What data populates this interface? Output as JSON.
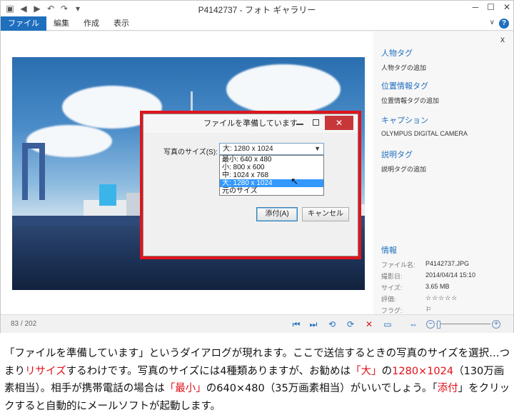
{
  "window": {
    "title": "P4142737 - フォト ギャラリー",
    "min": "─",
    "max": "☐",
    "close": "✕"
  },
  "quick_access": [
    "▣",
    "◀",
    "▶",
    "↶",
    "↷",
    "▾"
  ],
  "menu": {
    "items": [
      "ファイル",
      "編集",
      "作成",
      "表示"
    ],
    "help": "?",
    "collapse": "∨"
  },
  "dialog": {
    "title": "ファイルを準備しています",
    "close": "✕",
    "size_label": "写真のサイズ(S):",
    "selected": "大: 1280 x 1024",
    "options": [
      "最小: 640 x 480",
      "小: 800 x 600",
      "中: 1024 x 768",
      "大: 1280 x 1024",
      "元のサイズ"
    ],
    "highlighted_index": 3,
    "attach_button": "添付(A)",
    "cancel_button": "キャンセル"
  },
  "side_panel": {
    "close": "x",
    "people_tag": {
      "title": "人物タグ",
      "add": "人物タグの追加"
    },
    "geo_tag": {
      "title": "位置情報タグ",
      "add": "位置情報タグの追加"
    },
    "caption": {
      "title": "キャプション",
      "value": "OLYMPUS DIGITAL CAMERA"
    },
    "desc_tag": {
      "title": "説明タグ",
      "add": "説明タグの追加"
    },
    "info": {
      "title": "情報",
      "rows": [
        {
          "key": "ファイル名:",
          "value": "P4142737.JPG"
        },
        {
          "key": "撮影日:",
          "value": "2014/04/14 15:10"
        },
        {
          "key": "サイズ:",
          "value": "3.65 MB"
        },
        {
          "key": "評価:",
          "value": "☆☆☆☆☆"
        },
        {
          "key": "フラグ:",
          "value": "⚐"
        }
      ],
      "rating": 0
    }
  },
  "statusbar": {
    "counter": "83 / 202",
    "tools": [
      "⏮",
      "⏭",
      "⟲",
      "⟳",
      "✕",
      "▭",
      "⇔"
    ],
    "zoom_minus": "−",
    "zoom_plus": "+",
    "zoom_level": 0.02
  },
  "caption": {
    "p1": "「ファイルを準備しています」というダイアログが現れます。ここで送信するときの写真のサイズを選択…つまり",
    "h1": "リサイズ",
    "p2": "するわけです。写真のサイズには4種類ありますが、お勧めは",
    "h2": "「大」",
    "p3": "の",
    "h3": "1280×1024",
    "p4": "（130万画素相当）。相手が携帯電話の場合は",
    "h4": "「最小」",
    "p5": "の640×480（35万画素相当）がいいでしょう。「",
    "h5": "添付",
    "p6": "」をクリックすると自動的にメールソフトが起動します。"
  },
  "colors": {
    "accent": "#1e6fbe",
    "highlight": "#e01018",
    "dialog_frame": "#e0141c"
  }
}
